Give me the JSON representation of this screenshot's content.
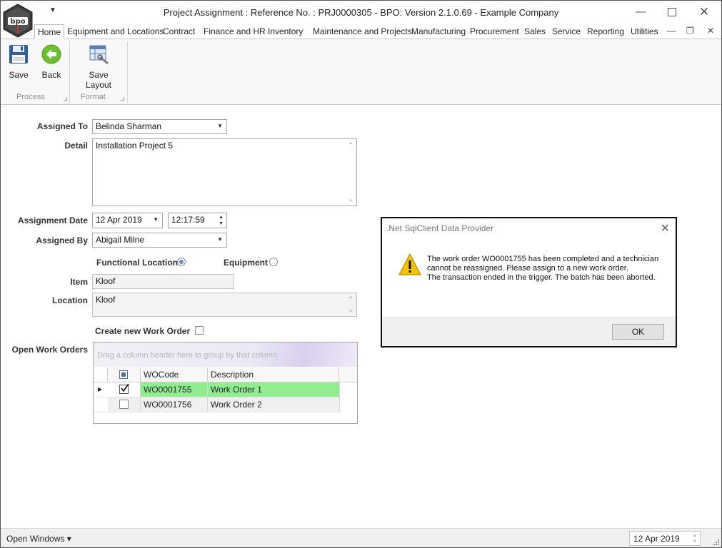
{
  "window": {
    "title": "Project Assignment : Reference No. : PRJ0000305 - BPO: Version 2.1.0.69 - Example Company",
    "logo_text": "bpo"
  },
  "tabs": [
    {
      "label": "Home",
      "active": true
    },
    {
      "label": "Equipment and Locations"
    },
    {
      "label": "Contract"
    },
    {
      "label": "Finance and HR"
    },
    {
      "label": "Inventory"
    },
    {
      "label": "Maintenance and Projects"
    },
    {
      "label": "Manufacturing"
    },
    {
      "label": "Procurement"
    },
    {
      "label": "Sales"
    },
    {
      "label": "Service"
    },
    {
      "label": "Reporting"
    },
    {
      "label": "Utilities"
    }
  ],
  "ribbon": {
    "save_label": "Save",
    "back_label": "Back",
    "save_layout_label": "Save Layout",
    "group_process": "Process",
    "group_format": "Format"
  },
  "form": {
    "assigned_to_label": "Assigned To",
    "assigned_to_value": "Belinda Sharman",
    "detail_label": "Detail",
    "detail_value": "Installation Project 5",
    "assignment_date_label": "Assignment Date",
    "assignment_date_value": "12 Apr 2019",
    "assignment_time_value": "12:17:59",
    "assigned_by_label": "Assigned By",
    "assigned_by_value": "Abigail Milne",
    "functional_location_label": "Functional Location",
    "functional_location_selected": true,
    "equipment_label": "Equipment",
    "equipment_selected": false,
    "item_label": "Item",
    "item_value": "Kloof",
    "location_label": "Location",
    "location_value": "Kloof",
    "create_wo_label": "Create new Work Order",
    "create_wo_checked": false,
    "open_wo_label": "Open Work Orders"
  },
  "grid": {
    "group_hint": "Drag a column header here to group by that column",
    "columns": [
      "WOCode",
      "Description"
    ],
    "rows": [
      {
        "code": "WO0001755",
        "description": "Work Order 1",
        "checked": true,
        "current": true,
        "highlight": "#90ee90"
      },
      {
        "code": "WO0001756",
        "description": "Work Order 2",
        "checked": false,
        "current": false
      }
    ]
  },
  "dialog": {
    "title": ".Net SqlClient Data Provider",
    "message_line1": "The work order WO0001755 has been completed and a technician cannot be reassigned. Please assign to a new work order.",
    "message_line2": "The transaction ended in the trigger. The batch has been aborted.",
    "ok_label": "OK",
    "icon": "warning-icon"
  },
  "statusbar": {
    "open_windows_label": "Open Windows ▾",
    "date_value": "12 Apr 2019"
  },
  "colors": {
    "highlight_row": "#90ee90",
    "warning_yellow": "#f5c400",
    "back_green": "#6cbf2f"
  }
}
